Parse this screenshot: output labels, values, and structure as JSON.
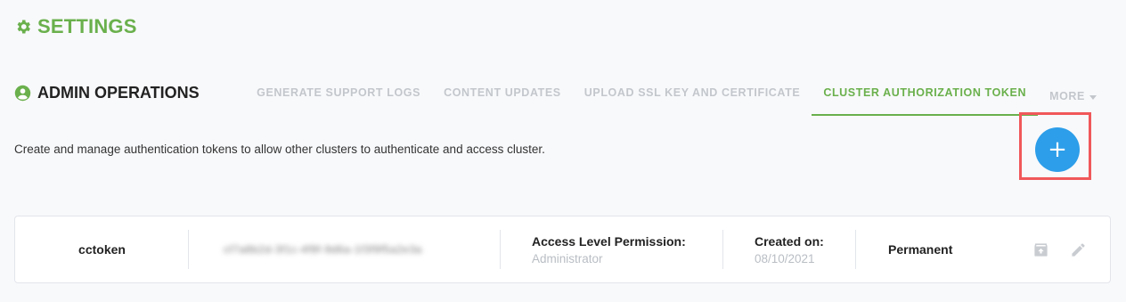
{
  "settings": {
    "title": "SETTINGS"
  },
  "section": {
    "title": "ADMIN OPERATIONS"
  },
  "tabs": [
    {
      "label": "GENERATE SUPPORT LOGS"
    },
    {
      "label": "CONTENT UPDATES"
    },
    {
      "label": "UPLOAD SSL KEY AND CERTIFICATE"
    },
    {
      "label": "CLUSTER AUTHORIZATION TOKEN",
      "active": true
    },
    {
      "label": "MORE"
    }
  ],
  "description": "Create and manage authentication tokens to allow other clusters to authenticate and access cluster.",
  "add_button": {
    "symbol": "+"
  },
  "token": {
    "name": "cctoken",
    "value": "cf7a8b2d-3f1c-4f9f-9d6a-1f3f9f5a2e3a",
    "access_label": "Access Level Permission:",
    "access_value": "Administrator",
    "created_label": "Created on:",
    "created_value": "08/10/2021",
    "expiry": "Permanent"
  },
  "colors": {
    "brand_green": "#6ab04c",
    "accent_blue": "#2d9ee9",
    "highlight_red": "#f0585a"
  },
  "icons": [
    "gear-icon",
    "user-circle-icon",
    "plus-icon",
    "archive-icon",
    "pencil-icon",
    "chevron-down-icon"
  ]
}
